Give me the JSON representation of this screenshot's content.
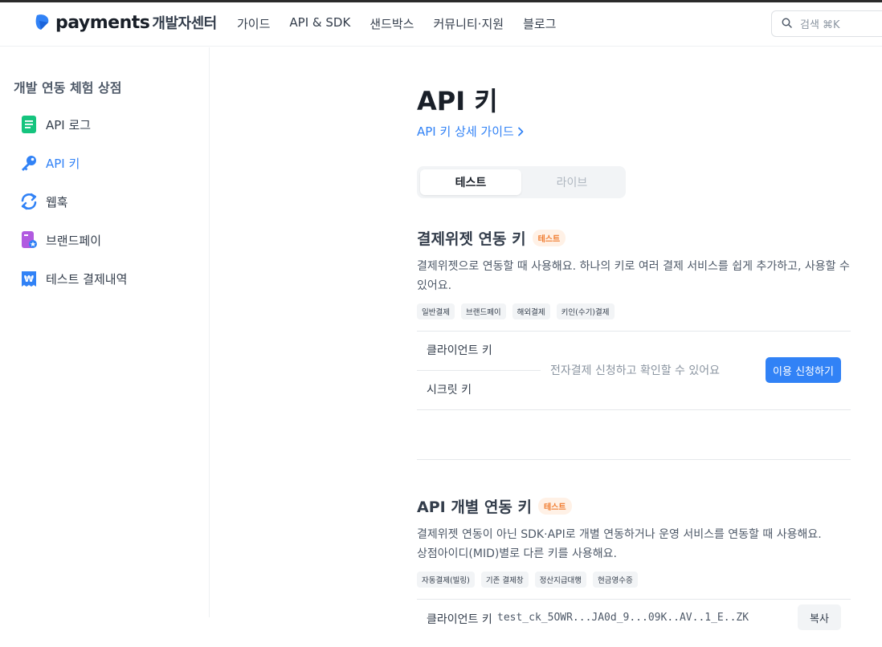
{
  "header": {
    "logo_word": "payments",
    "logo_sub": "개발자센터",
    "nav": [
      "가이드",
      "API & SDK",
      "샌드박스",
      "커뮤니티·지원",
      "블로그"
    ],
    "search_placeholder": "검색 ⌘K"
  },
  "sidebar": {
    "title": "개발 연동 체험 상점",
    "items": [
      {
        "label": "API 로그",
        "icon": "document-icon",
        "active": false
      },
      {
        "label": "API 키",
        "icon": "key-icon",
        "active": true
      },
      {
        "label": "웹훅",
        "icon": "refresh-icon",
        "active": false
      },
      {
        "label": "브랜드페이",
        "icon": "brandpay-icon",
        "active": false
      },
      {
        "label": "테스트 결제내역",
        "icon": "receipt-won-icon",
        "active": false
      }
    ]
  },
  "main": {
    "title": "API 키",
    "guide_link": "API 키 상세 가이드",
    "tabs": [
      {
        "label": "테스트",
        "active": true
      },
      {
        "label": "라이브",
        "active": false
      }
    ],
    "widget_section": {
      "title": "결제위젯 연동 키",
      "badge": "테스트",
      "description": "결제위젯으로 연동할 때 사용해요. 하나의 키로 여러 결제 서비스를 쉽게 추가하고, 사용할 수 있어요.",
      "chips": [
        "일반결제",
        "브랜드페이",
        "해외결제",
        "키인(수기)결제"
      ],
      "client_key_label": "클라이언트 키",
      "secret_key_label": "시크릿 키",
      "message": "전자결제 신청하고 확인할 수 있어요",
      "apply_button": "이용 신청하기"
    },
    "api_section": {
      "title": "API 개별 연동 키",
      "badge": "테스트",
      "description_line1": "결제위젯 연동이 아닌 SDK·API로 개별 연동하거나 운영 서비스를 연동할 때 사용해요.",
      "description_line2": "상점아이디(MID)별로 다른 키를 사용해요.",
      "chips": [
        "자동결제(빌링)",
        "기존 결제창",
        "정산지급대행",
        "현금영수증"
      ],
      "client_key_label": "클라이언트 키",
      "client_key_value": "test_ck_5OWR...JA0d_9...09K..AV..1_E..ZK",
      "copy_button": "복사"
    }
  },
  "colors": {
    "accent": "#3182f6",
    "badge_text": "#f07c30",
    "badge_bg": "#fff1e6"
  }
}
